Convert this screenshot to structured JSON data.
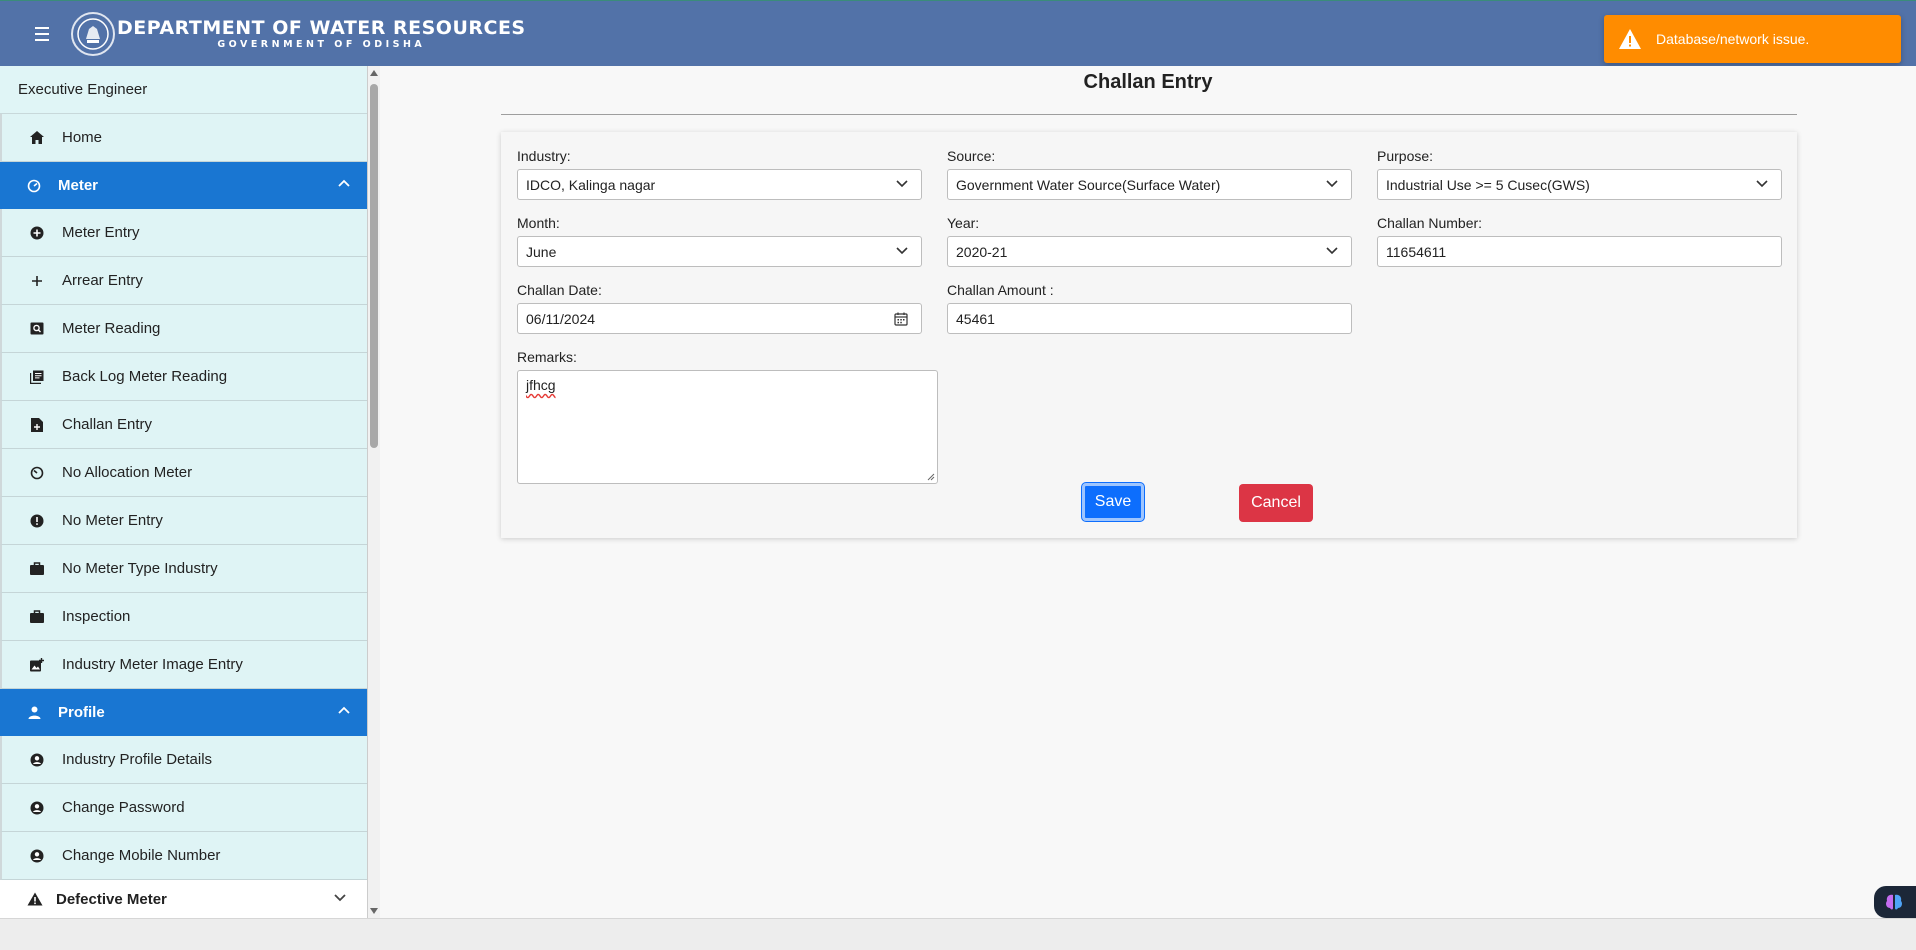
{
  "header": {
    "title": "DEPARTMENT OF WATER RESOURCES",
    "subtitle": "GOVERNMENT OF ODISHA",
    "menu_icon": "hamburger-icon",
    "emblem": "odisha-emblem-logo"
  },
  "toast": {
    "message": "Database/network issue.",
    "icon": "warning-icon",
    "color": "#ff8c00"
  },
  "sidebar": {
    "role": "Executive Engineer",
    "home": {
      "label": "Home",
      "icon": "home-icon"
    },
    "meter_group": {
      "label": "Meter",
      "icon": "gauge-icon",
      "expanded": true
    },
    "meter_items": [
      {
        "label": "Meter Entry",
        "icon": "add-circle-icon"
      },
      {
        "label": "Arrear Entry",
        "icon": "plus-icon"
      },
      {
        "label": "Meter Reading",
        "icon": "search-image-icon"
      },
      {
        "label": "Back Log Meter Reading",
        "icon": "library-books-icon"
      },
      {
        "label": "Challan Entry",
        "icon": "document-add-icon"
      },
      {
        "label": "No Allocation Meter",
        "icon": "gauge-off-icon"
      },
      {
        "label": "No Meter Entry",
        "icon": "error-circle-icon"
      },
      {
        "label": "No Meter Type Industry",
        "icon": "briefcase-icon"
      },
      {
        "label": "Inspection",
        "icon": "briefcase-icon"
      },
      {
        "label": "Industry Meter Image Entry",
        "icon": "add-photo-icon"
      }
    ],
    "profile_group": {
      "label": "Profile",
      "icon": "person-icon",
      "expanded": true
    },
    "profile_items": [
      {
        "label": "Industry Profile Details",
        "icon": "account-circle-icon"
      },
      {
        "label": "Change Password",
        "icon": "account-circle-icon"
      },
      {
        "label": "Change Mobile Number",
        "icon": "account-circle-icon"
      }
    ],
    "defective": {
      "label": "Defective Meter",
      "icon": "warning-icon",
      "expanded": false
    },
    "accent": "#1976d2"
  },
  "form": {
    "title": "Challan Entry",
    "industry": {
      "label": "Industry:",
      "value": "IDCO, Kalinga nagar"
    },
    "source": {
      "label": "Source:",
      "value": "Government Water Source(Surface Water)"
    },
    "purpose": {
      "label": "Purpose:",
      "value": "Industrial Use >= 5 Cusec(GWS)"
    },
    "month": {
      "label": "Month:",
      "value": "June"
    },
    "year": {
      "label": "Year:",
      "value": "2020-21"
    },
    "challan_number": {
      "label": "Challan Number:",
      "value": "11654611"
    },
    "challan_date": {
      "label": "Challan Date:",
      "value": "06/11/2024"
    },
    "challan_amount": {
      "label": "Challan Amount :",
      "value": "45461"
    },
    "remarks": {
      "label": "Remarks:",
      "value": "jfhcg"
    },
    "save_label": "Save",
    "cancel_label": "Cancel",
    "save_color": "#0d6efd",
    "cancel_color": "#dc3545"
  }
}
